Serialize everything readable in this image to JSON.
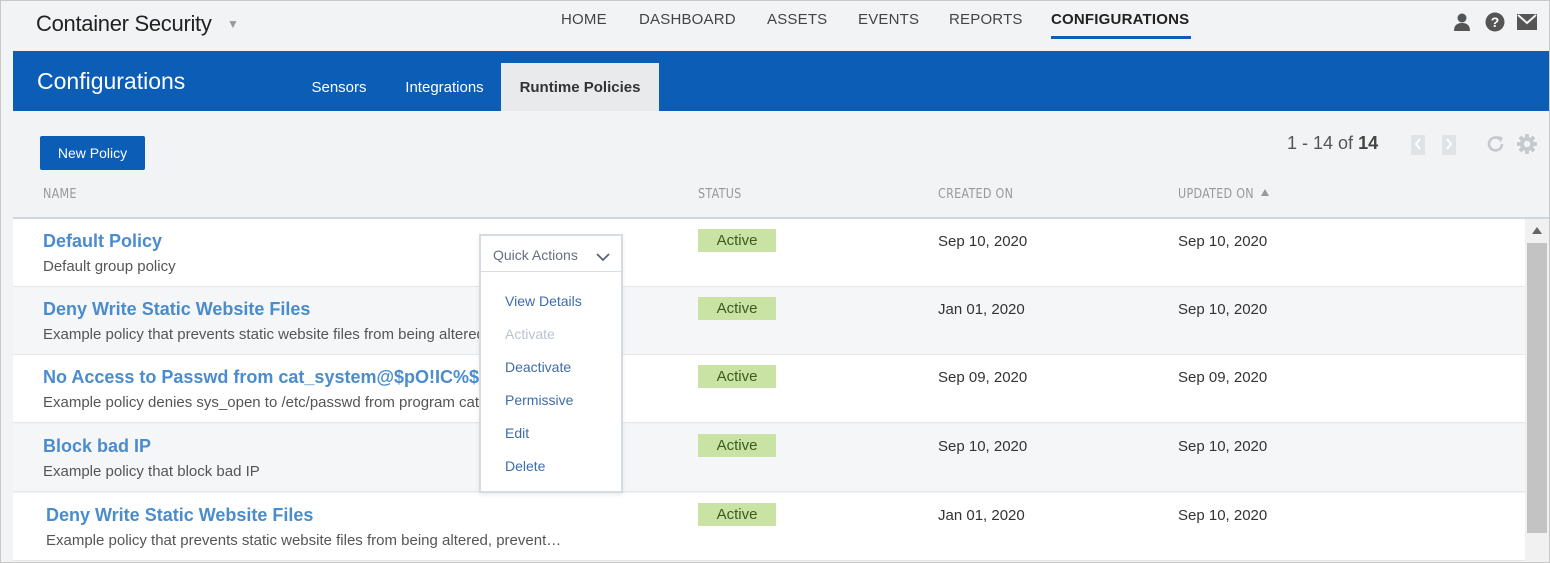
{
  "app": {
    "title": "Container Security"
  },
  "nav": {
    "items": [
      "HOME",
      "DASHBOARD",
      "ASSETS",
      "EVENTS",
      "REPORTS",
      "CONFIGURATIONS"
    ],
    "active": "CONFIGURATIONS",
    "icons": [
      "user-icon",
      "help-icon",
      "mail-icon"
    ]
  },
  "header": {
    "title": "Configurations",
    "tabs": [
      "Sensors",
      "Integrations",
      "Runtime Policies"
    ],
    "active_tab": "Runtime Policies",
    "accent_color": "#0b5db6"
  },
  "toolbar": {
    "new_policy_label": "New Policy",
    "pager_range": "1 - 14 of",
    "pager_total": "14"
  },
  "table": {
    "columns": [
      "NAME",
      "STATUS",
      "CREATED ON",
      "UPDATED ON"
    ],
    "sorted_column": "UPDATED ON",
    "sort_direction": "ascending",
    "rows": [
      {
        "name": "Default Policy",
        "description": "Default group policy",
        "status": "Active",
        "created_on": "Sep 10, 2020",
        "updated_on": "Sep 10, 2020"
      },
      {
        "name": "Deny Write Static Website Files",
        "description": "Example policy that prevents static website files from being altered, prevent…",
        "status": "Active",
        "created_on": "Jan 01, 2020",
        "updated_on": "Sep 10, 2020"
      },
      {
        "name": "No Access to Passwd from cat_system@$pO!IC%$",
        "description": "Example policy denies sys_open to /etc/passwd from program cat",
        "status": "Active",
        "created_on": "Sep 09, 2020",
        "updated_on": "Sep 09, 2020"
      },
      {
        "name": "Block bad IP",
        "description": "Example policy that block bad IP",
        "status": "Active",
        "created_on": "Sep 10, 2020",
        "updated_on": "Sep 10, 2020"
      },
      {
        "name": "Deny Write Static Website Files",
        "description": "Example policy that prevents static website files from being altered, prevent…",
        "status": "Active",
        "created_on": "Jan 01, 2020",
        "updated_on": "Sep 10, 2020"
      }
    ]
  },
  "quick_actions": {
    "label": "Quick Actions",
    "items": [
      {
        "label": "View Details",
        "enabled": true
      },
      {
        "label": "Activate",
        "enabled": false
      },
      {
        "label": "Deactivate",
        "enabled": true
      },
      {
        "label": "Permissive",
        "enabled": true
      },
      {
        "label": "Edit",
        "enabled": true
      },
      {
        "label": "Delete",
        "enabled": true
      }
    ]
  },
  "colors": {
    "status_active_bg": "#c9e3a5",
    "link": "#4a8ccc"
  }
}
